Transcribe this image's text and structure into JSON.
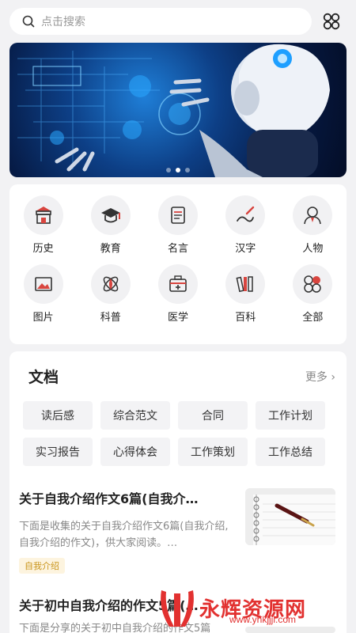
{
  "search": {
    "placeholder": "点击搜索"
  },
  "categories": [
    {
      "label": "历史",
      "icon": "building-icon"
    },
    {
      "label": "教育",
      "icon": "graduation-cap-icon"
    },
    {
      "label": "名言",
      "icon": "scroll-icon"
    },
    {
      "label": "汉字",
      "icon": "brush-icon"
    },
    {
      "label": "人物",
      "icon": "person-icon"
    },
    {
      "label": "图片",
      "icon": "picture-icon"
    },
    {
      "label": "科普",
      "icon": "atom-icon"
    },
    {
      "label": "医学",
      "icon": "medical-kit-icon"
    },
    {
      "label": "百科",
      "icon": "books-icon"
    },
    {
      "label": "全部",
      "icon": "grid-icon"
    }
  ],
  "documents": {
    "title": "文档",
    "more": "更多",
    "tags": [
      "读后感",
      "综合范文",
      "合同",
      "工作计划",
      "实习报告",
      "心得体会",
      "工作策划",
      "工作总结"
    ]
  },
  "articles": [
    {
      "title": "关于自我介绍作文6篇(自我介…",
      "desc": "下面是收集的关于自我介绍作文6篇(自我介绍,自我介绍的作文)，供大家阅读。…",
      "tag": "自我介绍"
    },
    {
      "title": "关于初中自我介绍的作文5篇(…",
      "desc": "下面是分享的关于初中自我介绍的作文5篇"
    }
  ],
  "watermark": {
    "text": "永辉资源网",
    "url": "www.yhkjjjl.com"
  },
  "colors": {
    "accent": "#e23130",
    "tag_text": "#c9941a",
    "icon_red": "#d8453f"
  }
}
